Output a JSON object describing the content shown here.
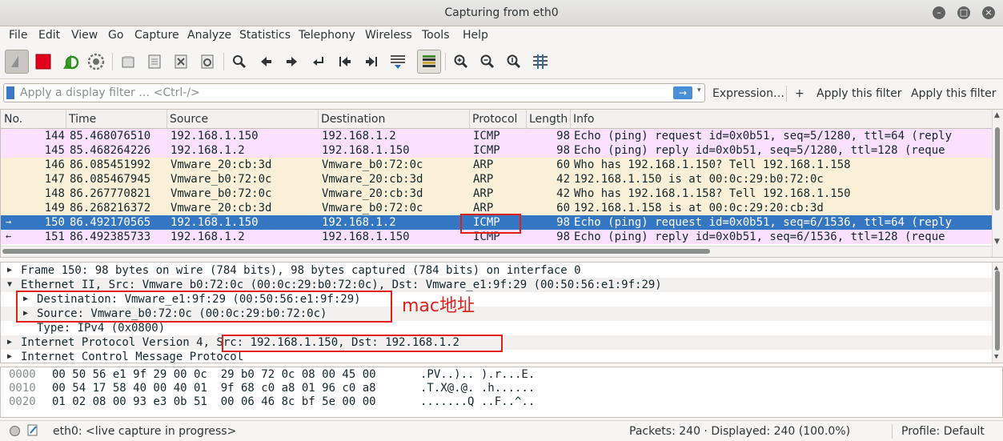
{
  "window": {
    "title": "Capturing from eth0",
    "minimize_glyph": "–",
    "maximize_glyph": "□",
    "close_glyph": "×"
  },
  "menu": [
    "File",
    "Edit",
    "View",
    "Go",
    "Capture",
    "Analyze",
    "Statistics",
    "Telephony",
    "Wireless",
    "Tools",
    "Help"
  ],
  "toolbar_icons": [
    "shark-fin-start-icon",
    "stop-square-icon",
    "restart-capture-icon",
    "capture-options-gear-icon",
    "open-file-icon",
    "save-file-icon",
    "close-file-icon",
    "reload-file-icon",
    "find-packet-icon",
    "go-back-icon",
    "go-forward-icon",
    "go-to-packet-icon",
    "first-packet-icon",
    "last-packet-icon",
    "autoscroll-icon",
    "colorize-icon",
    "zoom-in-icon",
    "zoom-out-icon",
    "zoom-reset-icon",
    "resize-columns-icon"
  ],
  "filter": {
    "placeholder": "Apply a display filter … <Ctrl-/>",
    "apply_arrow": "→",
    "dropdown_glyph": "▾",
    "expression_label": "Expression…",
    "plus_label": "+",
    "apply_filter_1": "Apply this filter",
    "apply_filter_2": "Apply this filter"
  },
  "packet_columns": [
    "No.",
    "Time",
    "Source",
    "Destination",
    "Protocol",
    "Length",
    "Info"
  ],
  "packets": [
    {
      "no": "144",
      "time": "85.468076510",
      "src": "192.168.1.150",
      "dst": "192.168.1.2",
      "proto": "ICMP",
      "len": "98",
      "info": "Echo (ping) request  id=0x0b51, seq=5/1280, ttl=64 (reply",
      "kind": "icmp",
      "mark": ""
    },
    {
      "no": "145",
      "time": "85.468264226",
      "src": "192.168.1.2",
      "dst": "192.168.1.150",
      "proto": "ICMP",
      "len": "98",
      "info": "Echo (ping) reply    id=0x0b51, seq=5/1280, ttl=128 (reque",
      "kind": "icmp",
      "mark": ""
    },
    {
      "no": "146",
      "time": "86.085451992",
      "src": "Vmware_20:cb:3d",
      "dst": "Vmware_b0:72:0c",
      "proto": "ARP",
      "len": "60",
      "info": "Who has 192.168.1.150? Tell 192.168.1.158",
      "kind": "arp",
      "mark": ""
    },
    {
      "no": "147",
      "time": "86.085467945",
      "src": "Vmware_b0:72:0c",
      "dst": "Vmware_20:cb:3d",
      "proto": "ARP",
      "len": "42",
      "info": "192.168.1.150 is at 00:0c:29:b0:72:0c",
      "kind": "arp",
      "mark": ""
    },
    {
      "no": "148",
      "time": "86.267770821",
      "src": "Vmware_b0:72:0c",
      "dst": "Vmware_20:cb:3d",
      "proto": "ARP",
      "len": "42",
      "info": "Who has 192.168.1.158? Tell 192.168.1.150",
      "kind": "arp",
      "mark": ""
    },
    {
      "no": "149",
      "time": "86.268216372",
      "src": "Vmware_20:cb:3d",
      "dst": "Vmware_b0:72:0c",
      "proto": "ARP",
      "len": "60",
      "info": "192.168.1.158 is at 00:0c:29:20:cb:3d",
      "kind": "arp",
      "mark": ""
    },
    {
      "no": "150",
      "time": "86.492170565",
      "src": "192.168.1.150",
      "dst": "192.168.1.2",
      "proto": "ICMP",
      "len": "98",
      "info": "Echo (ping) request  id=0x0b51, seq=6/1536, ttl=64 (reply",
      "kind": "sel",
      "mark": "→"
    },
    {
      "no": "151",
      "time": "86.492385733",
      "src": "192.168.1.2",
      "dst": "192.168.1.150",
      "proto": "ICMP",
      "len": "98",
      "info": "Echo (ping) reply    id=0x0b51, seq=6/1536, ttl=128 (reque",
      "kind": "icmp",
      "mark": "←"
    }
  ],
  "details": [
    {
      "arrow": "▶",
      "text": "Frame 150: 98 bytes on wire (784 bits), 98 bytes captured (784 bits) on interface 0",
      "indent": 0
    },
    {
      "arrow": "▼",
      "text": "Ethernet II, Src: Vmware_b0:72:0c (00:0c:29:b0:72:0c), Dst: Vmware_e1:9f:29 (00:50:56:e1:9f:29)",
      "indent": 0
    },
    {
      "arrow": "▶",
      "text": "Destination: Vmware_e1:9f:29 (00:50:56:e1:9f:29)",
      "indent": 1
    },
    {
      "arrow": "▶",
      "text": "Source: Vmware_b0:72:0c (00:0c:29:b0:72:0c)",
      "indent": 1
    },
    {
      "arrow": "",
      "text": "Type: IPv4 (0x0800)",
      "indent": 1
    },
    {
      "arrow": "▶",
      "text": "Internet Protocol Version 4, Src: 192.168.1.150, Dst: 192.168.1.2",
      "indent": 0
    },
    {
      "arrow": "▶",
      "text": "Internet Control Message Protocol",
      "indent": 0
    }
  ],
  "bytes": [
    {
      "offset": "0000",
      "hex": "00 50 56 e1 9f 29 00 0c  29 b0 72 0c 08 00 45 00",
      "ascii": ".PV..).. ).r...E."
    },
    {
      "offset": "0010",
      "hex": "00 54 17 58 40 00 40 01  9f 68 c0 a8 01 96 c0 a8",
      "ascii": ".T.X@.@. .h......"
    },
    {
      "offset": "0020",
      "hex": "01 02 08 00 93 e3 0b 51  00 06 46 8c bf 5e 00 00",
      "ascii": ".......Q ..F..^.."
    }
  ],
  "status": {
    "interface": "eth0: <live capture in progress>",
    "packets": "Packets: 240 · Displayed: 240 (100.0%)",
    "profile": "Profile: Default"
  },
  "annotation": {
    "label": "mac地址"
  },
  "colors": {
    "icmp_row": "#fce0ff",
    "arp_row": "#faf0d7",
    "selected_row": "#3476c1",
    "annotation_red": "#e0201a"
  }
}
